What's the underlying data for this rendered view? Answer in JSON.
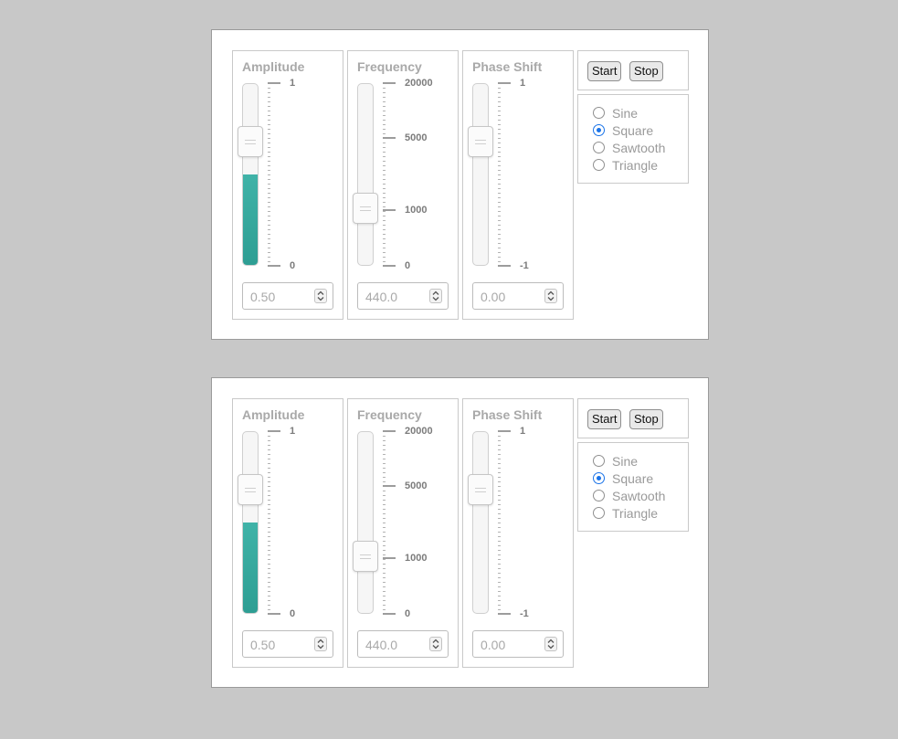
{
  "instances": [
    {
      "sliders": [
        {
          "title": "Amplitude",
          "value": "0.50",
          "tick_labels": [
            "1",
            "0"
          ]
        },
        {
          "title": "Frequency",
          "value": "440.0",
          "tick_labels": [
            "20000",
            "5000",
            "1000",
            "0"
          ]
        },
        {
          "title": "Phase Shift",
          "value": "0.00",
          "tick_labels": [
            "1",
            "-1"
          ]
        }
      ],
      "buttons": {
        "start": "Start",
        "stop": "Stop"
      },
      "waveforms": [
        "Sine",
        "Square",
        "Sawtooth",
        "Triangle"
      ],
      "selected_waveform": "Square"
    },
    {
      "sliders": [
        {
          "title": "Amplitude",
          "value": "0.50",
          "tick_labels": [
            "1",
            "0"
          ]
        },
        {
          "title": "Frequency",
          "value": "440.0",
          "tick_labels": [
            "20000",
            "5000",
            "1000",
            "0"
          ]
        },
        {
          "title": "Phase Shift",
          "value": "0.00",
          "tick_labels": [
            "1",
            "-1"
          ]
        }
      ],
      "buttons": {
        "start": "Start",
        "stop": "Stop"
      },
      "waveforms": [
        "Sine",
        "Square",
        "Sawtooth",
        "Triangle"
      ],
      "selected_waveform": "Square"
    }
  ],
  "colors": {
    "accent": "#2e9e93",
    "radio_selected": "#1a73e8"
  },
  "slider_levels": {
    "amplitude": 0.5,
    "frequency_hz": 440,
    "phase_shift": 0.0
  }
}
